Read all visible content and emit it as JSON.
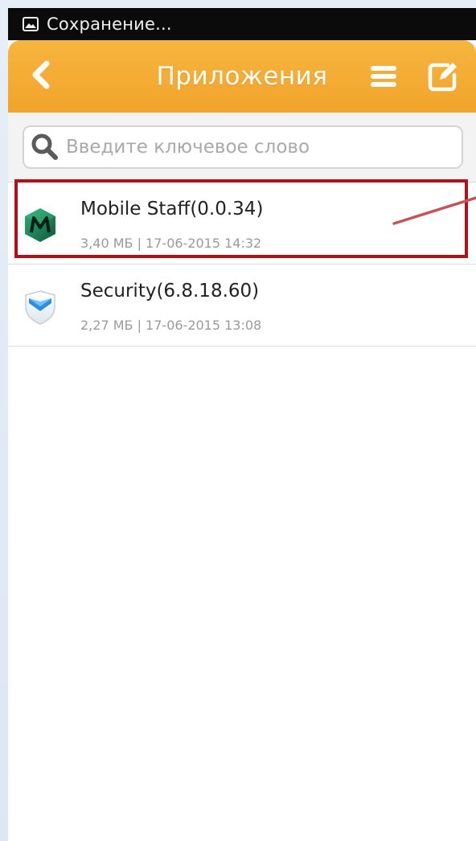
{
  "status_bar": {
    "icon": "image-icon",
    "text": "Сохранение..."
  },
  "app_bar": {
    "title": "Приложения",
    "back_icon": "chevron-left-icon",
    "menu_icon": "menu-icon",
    "edit_icon": "edit-icon",
    "color": "#f4ab34"
  },
  "search": {
    "placeholder": "Введите ключевое слово",
    "value": "",
    "icon": "search-icon"
  },
  "apps": [
    {
      "name": "Mobile Staff(0.0.34)",
      "meta": "3,40 МБ | 17-06-2015 14:32",
      "icon": "mobile-staff-icon",
      "highlighted": true
    },
    {
      "name": "Security(6.8.18.60)",
      "meta": "2,27 МБ | 17-06-2015 13:08",
      "icon": "security-shield-icon",
      "highlighted": false
    }
  ],
  "colors": {
    "accent": "#f4ab34",
    "highlight": "#b0121b",
    "icon_green": "#1f8a5b"
  }
}
